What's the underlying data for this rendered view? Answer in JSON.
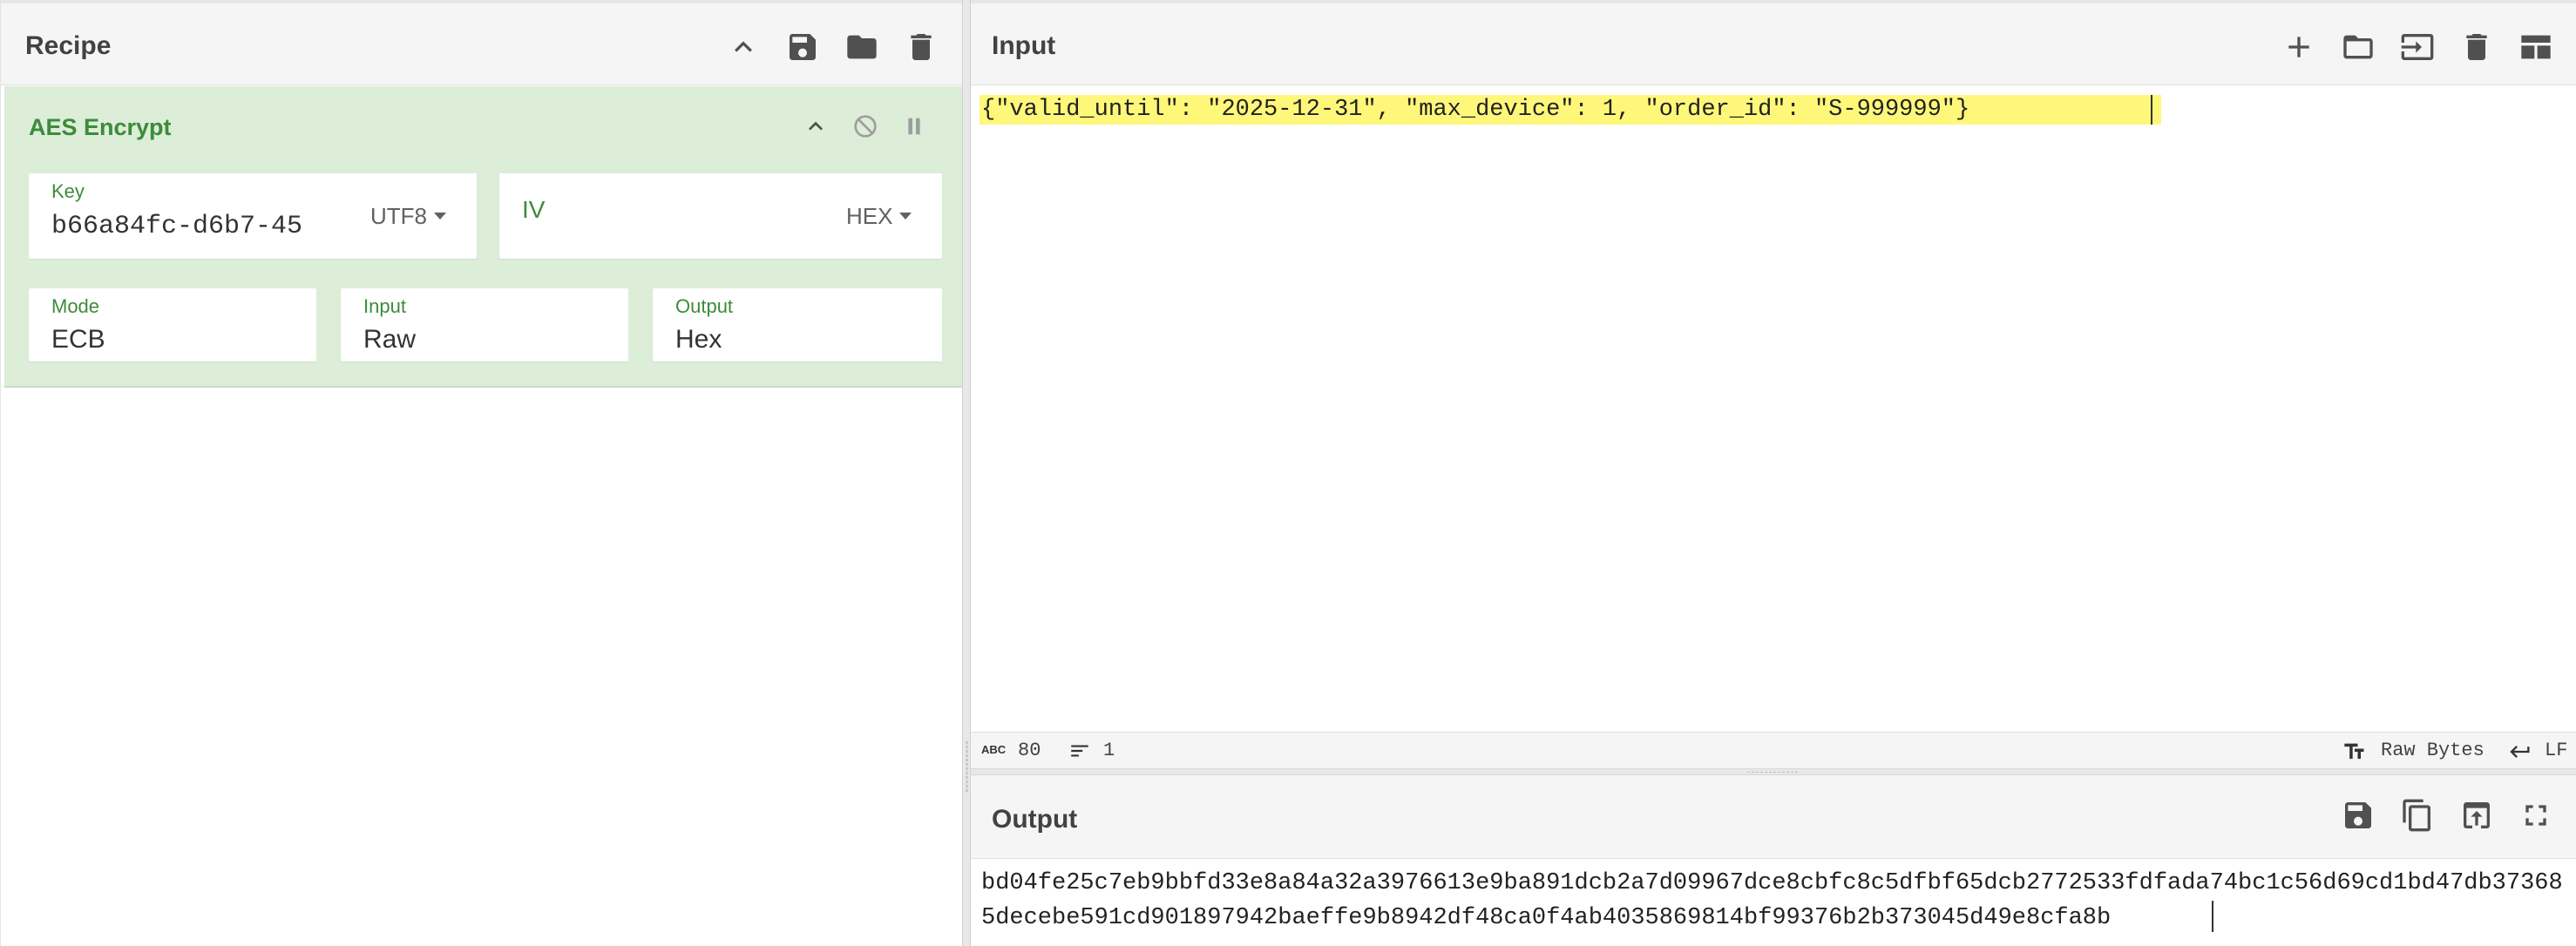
{
  "recipe": {
    "title": "Recipe",
    "icons": [
      "chevron-up-icon",
      "save-icon",
      "folder-icon",
      "trash-icon"
    ],
    "operation": {
      "name": "AES Encrypt",
      "key": {
        "label": "Key",
        "value": "b66a84fc-d6b7-45",
        "encoding": "UTF8"
      },
      "iv": {
        "label": "IV",
        "value": "",
        "encoding": "HEX"
      },
      "mode": {
        "label": "Mode",
        "value": "ECB"
      },
      "input": {
        "label": "Input",
        "value": "Raw"
      },
      "output": {
        "label": "Output",
        "value": "Hex"
      }
    }
  },
  "input": {
    "title": "Input",
    "text": "{\"valid_until\": \"2025-12-31\", \"max_device\": 1, \"order_id\": \"S-999999\"}",
    "status": {
      "chars": "80",
      "lines": "1",
      "encoding": "Raw Bytes",
      "eol": "LF"
    }
  },
  "output": {
    "title": "Output",
    "text": "bd04fe25c7eb9bbfd33e8a84a32a3976613e9ba891dcb2a7d09967dce8cbfc8c5dfbf65dcb2772533fdfada74bc1c56d69cd1bd47db373685decebe591cd901897942baeffe9b8942df48ca0f4ab4035869814bf99376b2b373045d49e8cfa8b"
  },
  "colors": {
    "accent_green": "#3c8b3c",
    "operation_bg": "#dcedd8",
    "highlight": "#fff77a"
  }
}
